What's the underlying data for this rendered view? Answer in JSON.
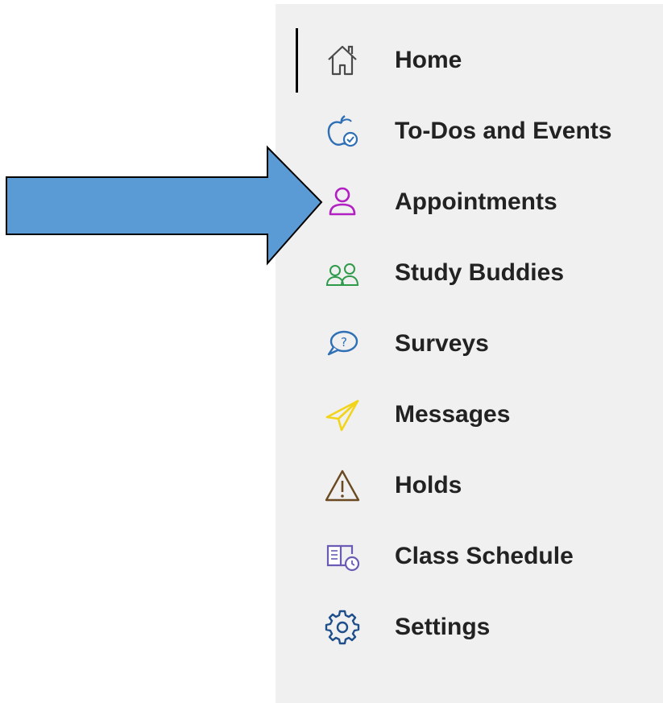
{
  "sidebar": {
    "active_item": "Home",
    "items": [
      {
        "label": "Home",
        "icon": "home-icon",
        "color": "#4a4a4a"
      },
      {
        "label": "To-Dos and Events",
        "icon": "apple-check-icon",
        "color": "#2f6fb5"
      },
      {
        "label": "Appointments",
        "icon": "person-icon",
        "color": "#b21fc2"
      },
      {
        "label": "Study Buddies",
        "icon": "people-icon",
        "color": "#2f9a4a"
      },
      {
        "label": "Surveys",
        "icon": "question-bubble-icon",
        "color": "#2f6fb5"
      },
      {
        "label": "Messages",
        "icon": "paper-plane-icon",
        "color": "#f2d41b"
      },
      {
        "label": "Holds",
        "icon": "warning-icon",
        "color": "#6b4a22"
      },
      {
        "label": "Class Schedule",
        "icon": "book-clock-icon",
        "color": "#6b5bb5"
      },
      {
        "label": "Settings",
        "icon": "gear-icon",
        "color": "#1f4f8a"
      }
    ]
  },
  "annotation": {
    "arrow_color": "#5b9bd5",
    "arrow_target": "Appointments"
  }
}
